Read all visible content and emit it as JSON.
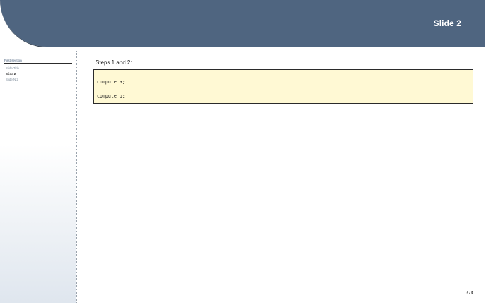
{
  "slide": {
    "title": "Slide 2"
  },
  "toc": {
    "section": "First section",
    "items": [
      {
        "label": "Slide Title",
        "active": false
      },
      {
        "label": "Slide 2",
        "active": true
      },
      {
        "label": "Slide N 2",
        "active": false
      }
    ]
  },
  "content": {
    "heading": "Steps 1 and 2:",
    "code_lines": [
      "compute a;",
      "compute b;"
    ]
  },
  "footer": {
    "page_number": "4 / 5"
  },
  "colors": {
    "header": "#4f6580",
    "code_background": "#fff9d4",
    "toc_inactive": "#7f8d9c"
  }
}
